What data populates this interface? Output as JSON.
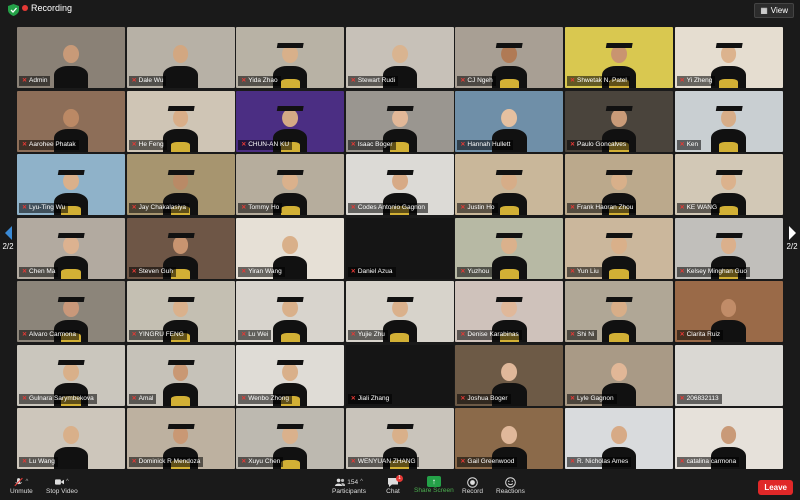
{
  "window": {
    "recording_label": "Recording",
    "view_label": "View"
  },
  "pager": {
    "left_label": "2/2",
    "right_label": "2/2"
  },
  "tiles": [
    {
      "name": "Admin",
      "wall": "#8a8176",
      "skin": "#c89a78",
      "grad": false,
      "muted": true
    },
    {
      "name": "Dale Wu",
      "wall": "#b7b1a6",
      "skin": "#d2a781",
      "grad": false,
      "muted": true
    },
    {
      "name": "Yida Zhao",
      "wall": "#b8b2a5",
      "skin": "#d8b08a",
      "grad": true,
      "muted": true
    },
    {
      "name": "Stewart Rudi",
      "wall": "#c7c1b8",
      "skin": "#d9b490",
      "grad": false,
      "muted": true
    },
    {
      "name": "CJ Ngeh",
      "wall": "#a89f94",
      "skin": "#b07a55",
      "grad": true,
      "muted": true
    },
    {
      "name": "Shwetak N. Patel",
      "wall": "#d9c850",
      "skin": "#c99470",
      "grad": true,
      "muted": true
    },
    {
      "name": "Yi Zheng",
      "wall": "#e5ddd0",
      "skin": "#dcb38e",
      "grad": true,
      "muted": true
    },
    {
      "name": "Aarohee Phatak",
      "wall": "#8d6e58",
      "skin": "#bb8965",
      "grad": false,
      "muted": true
    },
    {
      "name": "He Feng",
      "wall": "#cfc5b5",
      "skin": "#d9ae88",
      "grad": true,
      "muted": true
    },
    {
      "name": "CHUN-AN KU",
      "wall": "#4b2e83",
      "skin": "#d4aa85",
      "grad": true,
      "muted": true
    },
    {
      "name": "Isaac Boger",
      "wall": "#9a9690",
      "skin": "#e2b898",
      "grad": true,
      "muted": true
    },
    {
      "name": "Hannah Hullett",
      "wall": "#6f8fa8",
      "skin": "#e5c0a0",
      "grad": false,
      "muted": true
    },
    {
      "name": "Paulo Goncalves",
      "wall": "#4a443c",
      "skin": "#c99b78",
      "grad": true,
      "muted": true
    },
    {
      "name": "Ken",
      "wall": "#c9cfd2",
      "skin": "#d7ad88",
      "grad": true,
      "muted": true
    },
    {
      "name": "Lyu-Ting Wu",
      "wall": "#8fb2c9",
      "skin": "#d9b08b",
      "grad": true,
      "muted": true
    },
    {
      "name": "Jay Chakalasiya",
      "wall": "#a7956f",
      "skin": "#b98a66",
      "grad": true,
      "muted": true
    },
    {
      "name": "Tommy Ho",
      "wall": "#b6ad9d",
      "skin": "#dab18c",
      "grad": true,
      "muted": true
    },
    {
      "name": "Codes Antonio Gagnon",
      "wall": "#dcdad6",
      "skin": "#d7aa86",
      "grad": true,
      "muted": true
    },
    {
      "name": "Justin Ho",
      "wall": "#c9b79a",
      "skin": "#d6ad88",
      "grad": true,
      "muted": true
    },
    {
      "name": "Frank Haoran Zhou",
      "wall": "#bba98c",
      "skin": "#d8b08a",
      "grad": true,
      "muted": true
    },
    {
      "name": "KE WANG",
      "wall": "#d2c8b6",
      "skin": "#dbb28d",
      "grad": true,
      "muted": true
    },
    {
      "name": "Chen Ma",
      "wall": "#b2aaa0",
      "skin": "#dcb290",
      "grad": true,
      "muted": true
    },
    {
      "name": "Steven Guh",
      "wall": "#6e5646",
      "skin": "#c89470",
      "grad": true,
      "muted": true
    },
    {
      "name": "Yiran Wang",
      "wall": "#e6e0d6",
      "skin": "#d9b08a",
      "grad": false,
      "muted": true
    },
    {
      "name": "Daniel Azua",
      "wall": "#151515",
      "skin": "#151515",
      "grad": false,
      "muted": true,
      "empty": true
    },
    {
      "name": "Yuzhou",
      "wall": "#b7b9a4",
      "skin": "#dab18c",
      "grad": true,
      "muted": true
    },
    {
      "name": "Yun Liu",
      "wall": "#cbb79c",
      "skin": "#d9b08a",
      "grad": true,
      "muted": true
    },
    {
      "name": "Kelsey Minghan Guo",
      "wall": "#c1bfbb",
      "skin": "#dbb08c",
      "grad": true,
      "muted": true
    },
    {
      "name": "Alvaro Carmona",
      "wall": "#8c857a",
      "skin": "#c9987a",
      "grad": true,
      "muted": true
    },
    {
      "name": "YINGRU FENG",
      "wall": "#c4bfb2",
      "skin": "#dab18c",
      "grad": true,
      "muted": true
    },
    {
      "name": "Lu Wei",
      "wall": "#d8d4cd",
      "skin": "#d9b08a",
      "grad": true,
      "muted": true
    },
    {
      "name": "Yujie Zhu",
      "wall": "#d7d3cb",
      "skin": "#dab18c",
      "grad": true,
      "muted": true
    },
    {
      "name": "Denise Karabinas",
      "wall": "#cfc2bb",
      "skin": "#e0b89a",
      "grad": true,
      "muted": true
    },
    {
      "name": "Shi Ni",
      "wall": "#b0a796",
      "skin": "#d8ae88",
      "grad": true,
      "muted": true
    },
    {
      "name": "Clarita Ruiz",
      "wall": "#9a6a48",
      "skin": "#c18c68",
      "grad": false,
      "muted": true
    },
    {
      "name": "Gulnara Sarymbekova",
      "wall": "#cac6bd",
      "skin": "#d9b08a",
      "grad": true,
      "muted": true
    },
    {
      "name": "Amal",
      "wall": "#c6c2b9",
      "skin": "#c99874",
      "grad": true,
      "muted": true
    },
    {
      "name": "Wenbo Zhong",
      "wall": "#dfdcd6",
      "skin": "#d9b08a",
      "grad": true,
      "muted": true
    },
    {
      "name": "Jiali Zhang",
      "wall": "#151515",
      "skin": "#151515",
      "grad": false,
      "muted": true,
      "empty": true
    },
    {
      "name": "Joshua Boger",
      "wall": "#6d5a46",
      "skin": "#e0b89a",
      "grad": false,
      "muted": true
    },
    {
      "name": "Lyle Gagnon",
      "wall": "#a99a86",
      "skin": "#e1b797",
      "grad": false,
      "muted": true
    },
    {
      "name": "206832113",
      "wall": "#dad8d3",
      "skin": "#dad8d3",
      "grad": false,
      "muted": true,
      "empty": true
    },
    {
      "name": "Lu Wang",
      "wall": "#cdc6bb",
      "skin": "#d9b08a",
      "grad": false,
      "muted": true
    },
    {
      "name": "Dominick R Mendoza",
      "wall": "#bdb1a0",
      "skin": "#c99874",
      "grad": true,
      "muted": true
    },
    {
      "name": "Xuyu Chen",
      "wall": "#bdb9b0",
      "skin": "#dab18c",
      "grad": true,
      "muted": true
    },
    {
      "name": "WENYUAN ZHANG",
      "wall": "#c9c4bb",
      "skin": "#d9b08a",
      "grad": true,
      "muted": true
    },
    {
      "name": "Gail Greenwood",
      "wall": "#8b6a4a",
      "skin": "#e0b89a",
      "grad": false,
      "muted": true
    },
    {
      "name": "R. Nicholas Ames",
      "wall": "#d9dbdd",
      "skin": "#d7aa86",
      "grad": false,
      "muted": true
    },
    {
      "name": "catalina carmona",
      "wall": "#e6e1da",
      "skin": "#c99a78",
      "grad": false,
      "muted": true
    }
  ],
  "toolbar": {
    "unmute": "Unmute",
    "stop_video": "Stop Video",
    "participants": "Participants",
    "participants_count": "154",
    "chat": "Chat",
    "chat_badge": "1",
    "share_screen": "Share Screen",
    "record": "Record",
    "reactions": "Reactions",
    "leave": "Leave"
  },
  "colors": {
    "accent_green": "#24a148",
    "leave_red": "#e02828",
    "active_speaker": "#f5d000",
    "uw_purple": "#4b2e83"
  }
}
